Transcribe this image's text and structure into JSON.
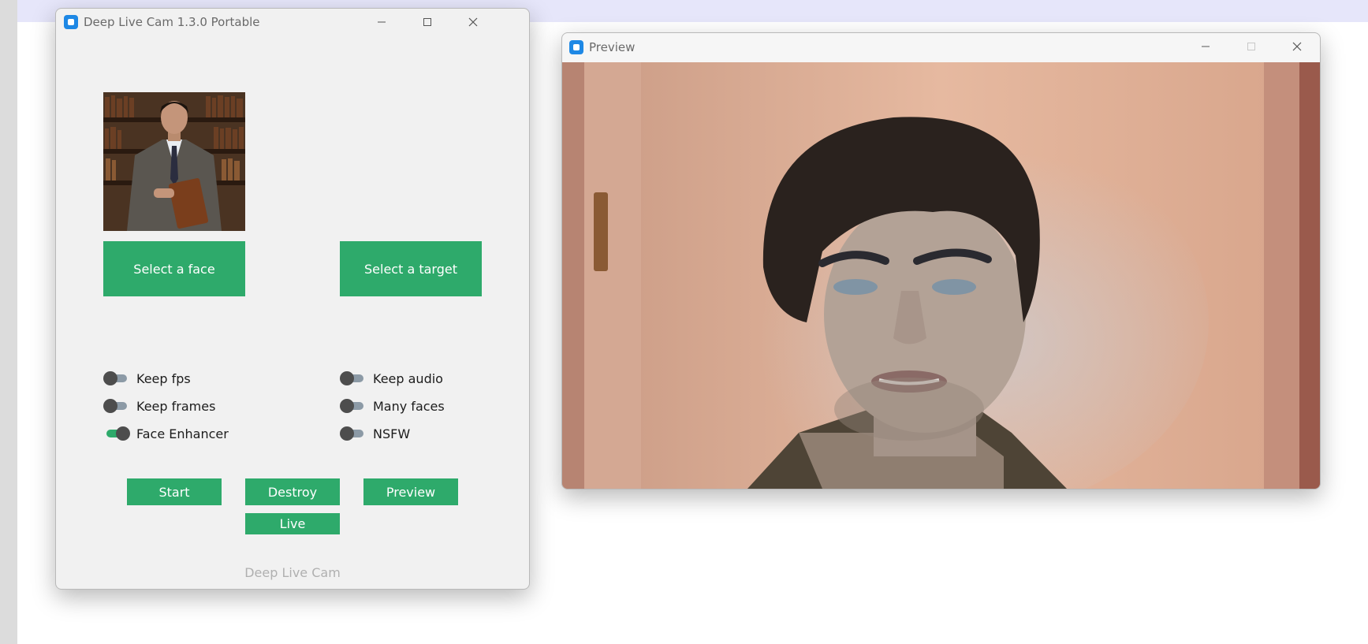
{
  "main_window": {
    "title": "Deep Live Cam 1.3.0 Portable",
    "buttons": {
      "select_face": "Select a face",
      "select_target": "Select a target",
      "start": "Start",
      "destroy": "Destroy",
      "preview": "Preview",
      "live": "Live"
    },
    "toggles": [
      {
        "label": "Keep fps",
        "on": false
      },
      {
        "label": "Keep frames",
        "on": false
      },
      {
        "label": "Face Enhancer",
        "on": true
      },
      {
        "label": "Keep audio",
        "on": false
      },
      {
        "label": "Many faces",
        "on": false
      },
      {
        "label": "NSFW",
        "on": false
      }
    ],
    "footer": "Deep Live Cam"
  },
  "preview_window": {
    "title": "Preview"
  },
  "colors": {
    "accent_green": "#2eaa6b",
    "window_bg": "#f1f1f1",
    "switch_off_track": "#8c9aa6",
    "switch_knob": "#4d4d4d",
    "title_band": "#e6e6fa"
  }
}
